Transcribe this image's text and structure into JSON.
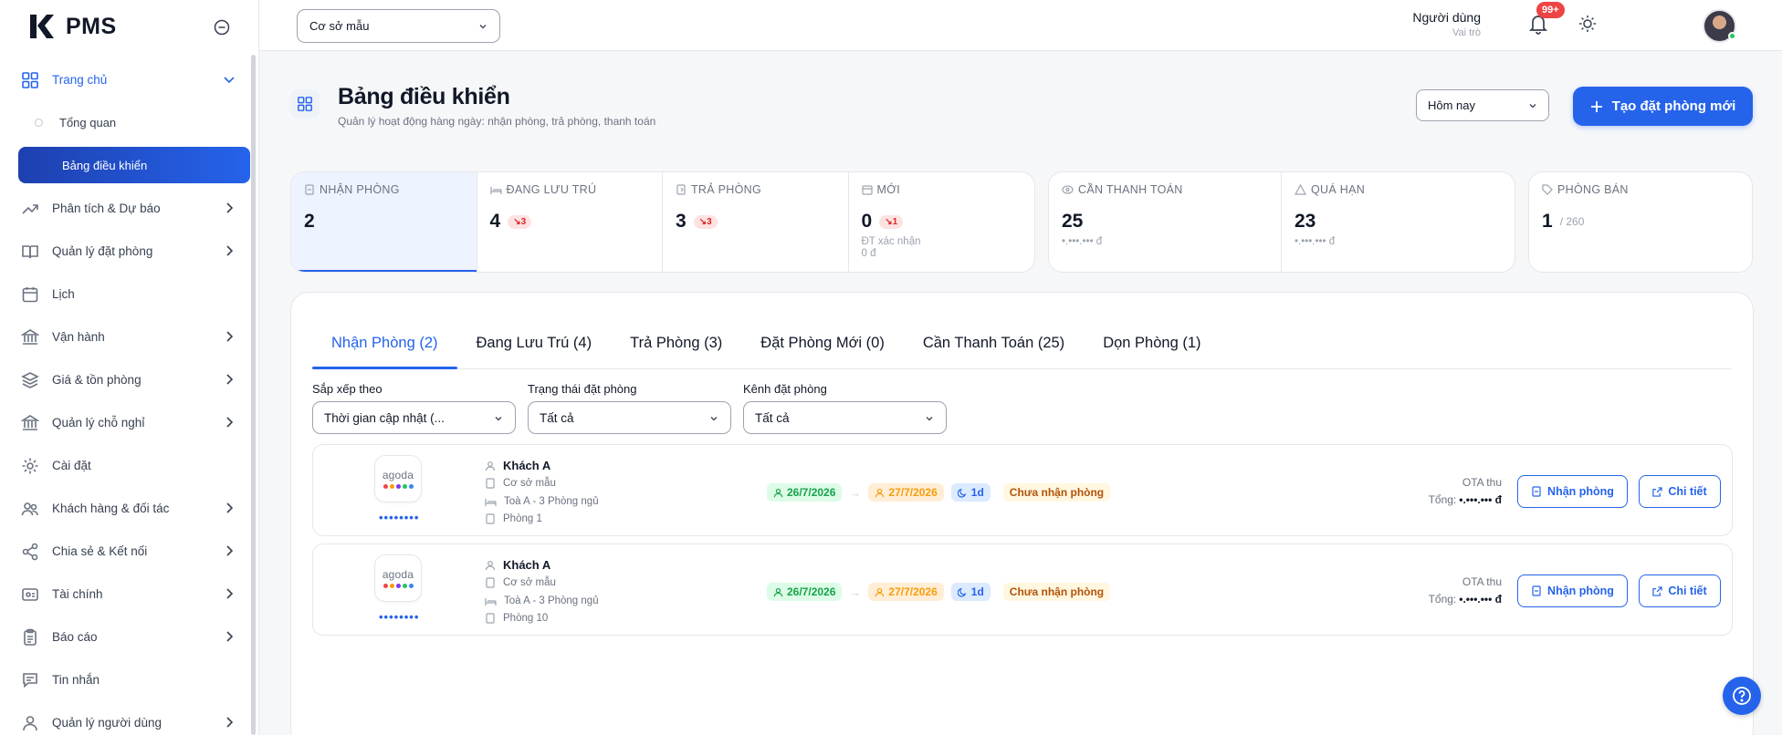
{
  "app": {
    "name": "PMS"
  },
  "sidebar": {
    "items": [
      {
        "label": "Trang chủ",
        "icon": "grid-icon"
      },
      {
        "label": "Tổng quan"
      },
      {
        "label": "Bảng điều khiển"
      },
      {
        "label": "Phân tích & Dự báo",
        "icon": "trend-icon"
      },
      {
        "label": "Quản lý đặt phòng",
        "icon": "book-icon"
      },
      {
        "label": "Lịch",
        "icon": "calendar-icon"
      },
      {
        "label": "Vận hành",
        "icon": "bank-icon"
      },
      {
        "label": "Giá & tồn phòng",
        "icon": "layers-icon"
      },
      {
        "label": "Quản lý chỗ nghỉ",
        "icon": "building-icon"
      },
      {
        "label": "Cài đặt",
        "icon": "gear-icon"
      },
      {
        "label": "Khách hàng & đối tác",
        "icon": "users-icon"
      },
      {
        "label": "Chia sẻ & Kết nối",
        "icon": "share-icon"
      },
      {
        "label": "Tài chính",
        "icon": "wallet-icon"
      },
      {
        "label": "Báo cáo",
        "icon": "clipboard-icon"
      },
      {
        "label": "Tin nhắn",
        "icon": "message-icon"
      },
      {
        "label": "Quản lý người dùng",
        "icon": "user-icon"
      }
    ]
  },
  "topbar": {
    "property": "Cơ sở mẫu",
    "notifications": "99+",
    "user_name": "Người dùng",
    "user_role": "Vai trò"
  },
  "page": {
    "title": "Bảng điều khiển",
    "subtitle": "Quản lý hoạt động hàng ngày: nhận phòng, trả phòng, thanh toán",
    "range": "Hôm nay",
    "create_label": "Tạo đặt phòng mới"
  },
  "stats": {
    "checkin": {
      "label": "NHẬN PHÒNG",
      "value": "2"
    },
    "staying": {
      "label": "ĐANG LƯU TRÚ",
      "value": "4",
      "chip": "↘3"
    },
    "checkout": {
      "label": "TRẢ PHÒNG",
      "value": "3",
      "chip": "↘3"
    },
    "new": {
      "label": "MỚI",
      "value": "0",
      "chip": "↘1",
      "sub1": "ĐT xác nhận",
      "sub2": "0 đ"
    },
    "payment": {
      "label": "CẦN THANH TOÁN",
      "value": "25",
      "sub": "•.•••.••• đ"
    },
    "overdue": {
      "label": "QUÁ HẠN",
      "value": "23",
      "sub": "•.•••.••• đ"
    },
    "sold": {
      "label": "PHÒNG BÁN",
      "value": "1",
      "total": "/ 260"
    }
  },
  "tabs": [
    "Nhận Phòng (2)",
    "Đang Lưu Trú (4)",
    "Trả Phòng (3)",
    "Đặt Phòng Mới (0)",
    "Cần Thanh Toán (25)",
    "Dọn Phòng (1)"
  ],
  "filters": {
    "sort": {
      "label": "Sắp xếp theo",
      "value": "Thời gian cập nhật (..."
    },
    "status": {
      "label": "Trạng thái đặt phòng",
      "value": "Tất cả"
    },
    "channel": {
      "label": "Kênh đặt phòng",
      "value": "Tất cả"
    }
  },
  "bookings": [
    {
      "ota": "agoda",
      "code": "••••••••",
      "guest": "Khách A",
      "property": "Cơ sở mẫu",
      "room_type": "Toà A - 3 Phòng ngủ",
      "room": "Phòng 1",
      "checkin": "26/7/2026",
      "checkout": "27/7/2026",
      "nights": "1d",
      "status": "Chưa nhận phòng",
      "ota_label": "OTA thu",
      "total_label": "Tổng:",
      "total": "•.•••.••• đ",
      "checkin_btn": "Nhận phòng",
      "detail_btn": "Chi tiết"
    },
    {
      "ota": "agoda",
      "code": "••••••••",
      "guest": "Khách A",
      "property": "Cơ sở mẫu",
      "room_type": "Toà A - 3 Phòng ngủ",
      "room": "Phòng 10",
      "checkin": "26/7/2026",
      "checkout": "27/7/2026",
      "nights": "1d",
      "status": "Chưa nhận phòng",
      "ota_label": "OTA thu",
      "total_label": "Tổng:",
      "total": "•.•••.••• đ",
      "checkin_btn": "Nhận phòng",
      "detail_btn": "Chi tiết"
    }
  ],
  "colors": {
    "primary": "#2563eb",
    "danger": "#ef4444",
    "success": "#16a34a",
    "warning": "#f59e0b"
  }
}
